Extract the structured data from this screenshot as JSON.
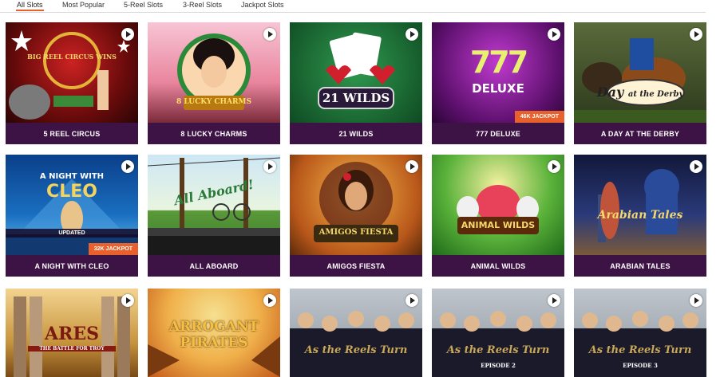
{
  "tabs": [
    {
      "label": "All Slots",
      "active": true
    },
    {
      "label": "Most Popular"
    },
    {
      "label": "5-Reel Slots"
    },
    {
      "label": "3-Reel Slots"
    },
    {
      "label": "Jackpot Slots"
    }
  ],
  "games": [
    {
      "title": "5 REEL CIRCUS",
      "logo": "BIG REEL CIRCUS WINS"
    },
    {
      "title": "8 LUCKY CHARMS",
      "logo": "8 LUCKY CHARMS"
    },
    {
      "title": "21 WILDS",
      "logo": "21 WILDS"
    },
    {
      "title": "777 DELUXE",
      "logo": "777",
      "logo2": "DELUXE",
      "jackpot": "46K JACKPOT"
    },
    {
      "title": "A DAY AT THE DERBY",
      "logo": "Day",
      "logo2": "at the Derby"
    },
    {
      "title": "A NIGHT WITH CLEO",
      "logo": "A NIGHT WITH",
      "logo2": "CLEO",
      "badge": "UPDATED",
      "jackpot": "32K JACKPOT"
    },
    {
      "title": "ALL ABOARD",
      "logo": "All Aboard!"
    },
    {
      "title": "AMIGOS FIESTA",
      "logo": "AMIGOS FIESTA"
    },
    {
      "title": "ANIMAL WILDS",
      "logo": "ANIMAL WILDS"
    },
    {
      "title": "ARABIAN TALES",
      "logo": "Arabian Tales"
    },
    {
      "title": "",
      "logo": "ARES",
      "logo2": "THE BATTLE FOR TROY"
    },
    {
      "title": "",
      "logo": "ARROGANT",
      "logo2": "PIRATES"
    },
    {
      "title": "",
      "logo": "As the Reels Turn"
    },
    {
      "title": "",
      "logo": "As the Reels Turn",
      "logo2": "EPISODE 2"
    },
    {
      "title": "",
      "logo": "As the Reels Turn",
      "logo2": "EPISODE 3"
    }
  ]
}
